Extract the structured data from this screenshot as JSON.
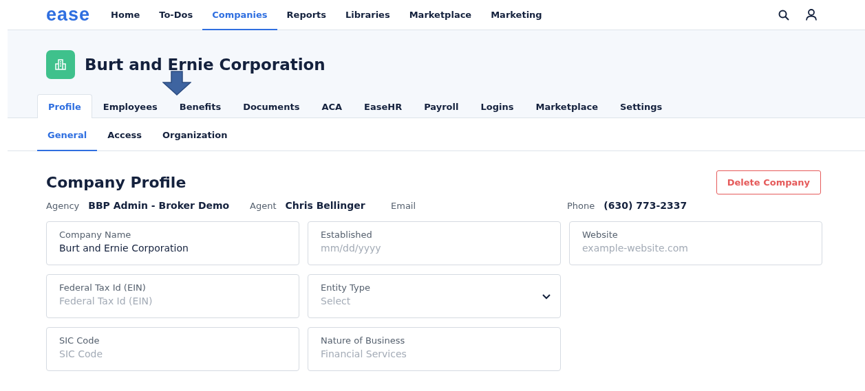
{
  "nav": {
    "logo": "ease",
    "items": [
      {
        "label": "Home",
        "selected": false
      },
      {
        "label": "To-Dos",
        "selected": false
      },
      {
        "label": "Companies",
        "selected": true
      },
      {
        "label": "Reports",
        "selected": false
      },
      {
        "label": "Libraries",
        "selected": false
      },
      {
        "label": "Marketplace",
        "selected": false
      },
      {
        "label": "Marketing",
        "selected": false
      }
    ]
  },
  "company": {
    "name": "Burt and Ernie Corporation"
  },
  "tabs": [
    {
      "label": "Profile",
      "selected": true
    },
    {
      "label": "Employees",
      "selected": false
    },
    {
      "label": "Benefits",
      "selected": false
    },
    {
      "label": "Documents",
      "selected": false
    },
    {
      "label": "ACA",
      "selected": false
    },
    {
      "label": "EaseHR",
      "selected": false
    },
    {
      "label": "Payroll",
      "selected": false
    },
    {
      "label": "Logins",
      "selected": false
    },
    {
      "label": "Marketplace",
      "selected": false
    },
    {
      "label": "Settings",
      "selected": false
    }
  ],
  "subtabs": [
    {
      "label": "General",
      "selected": true
    },
    {
      "label": "Access",
      "selected": false
    },
    {
      "label": "Organization",
      "selected": false
    }
  ],
  "profile": {
    "title": "Company Profile",
    "delete_button": "Delete Company",
    "info": [
      {
        "label": "Agency",
        "value": "BBP Admin - Broker Demo"
      },
      {
        "label": "Agent",
        "value": "Chris Bellinger"
      },
      {
        "label": "Email"
      },
      {
        "label": "Phone",
        "value": "(630) 773-2337"
      }
    ],
    "fields": [
      {
        "kind": "text",
        "label": "Company Name",
        "value": "Burt and Ernie Corporation"
      },
      {
        "kind": "text",
        "label": "Established",
        "placeholder": "mm/dd/yyyy"
      },
      {
        "kind": "text",
        "label": "Website",
        "placeholder": "example-website.com"
      },
      {
        "kind": "text",
        "label": "Federal Tax Id (EIN)",
        "placeholder": "Federal Tax Id (EIN)"
      },
      {
        "kind": "select",
        "label": "Entity Type",
        "placeholder": "Select"
      },
      {
        "kind": "empty"
      },
      {
        "kind": "text",
        "label": "SIC Code",
        "placeholder": "SIC Code"
      },
      {
        "kind": "text",
        "label": "Nature of Business",
        "placeholder": "Financial Services"
      }
    ]
  }
}
